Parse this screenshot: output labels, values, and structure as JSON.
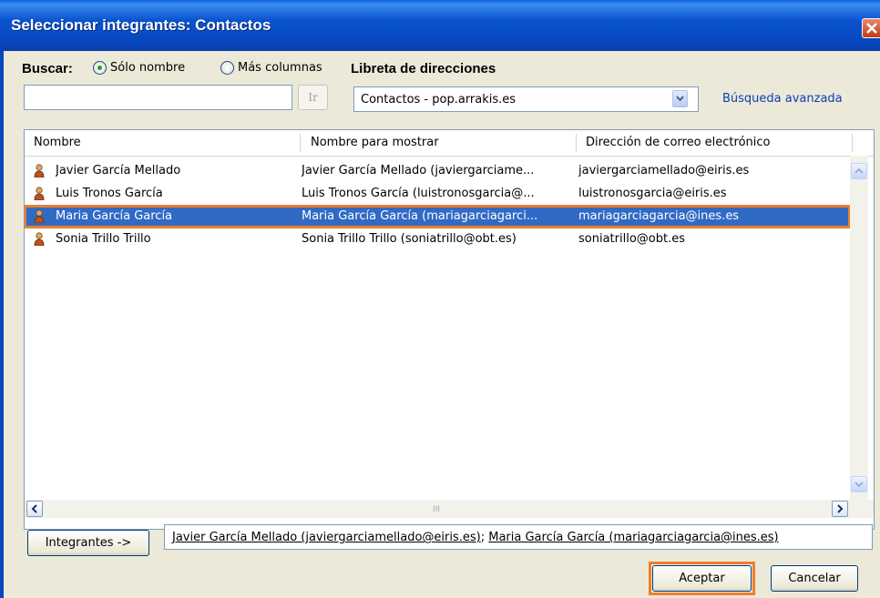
{
  "window": {
    "title": "Seleccionar integrantes: Contactos"
  },
  "search": {
    "label": "Buscar:",
    "option_name_only": "Sólo nombre",
    "option_more_columns": "Más columnas",
    "selected_option": "Sólo nombre",
    "query_value": "",
    "go_label": "Ir"
  },
  "address_book": {
    "label": "Libreta de direcciones",
    "selected": "Contactos - pop.arrakis.es",
    "advanced_search": "Búsqueda avanzada"
  },
  "table": {
    "columns": [
      "Nombre",
      "Nombre para mostrar",
      "Dirección de correo electrónico"
    ],
    "rows": [
      {
        "name": "Javier García Mellado",
        "display": "Javier García Mellado (javiergarciame...",
        "email": "javiergarciamellado@eiris.es",
        "selected": false
      },
      {
        "name": "Luis Tronos García",
        "display": "Luis Tronos García (luistronosgarcia@...",
        "email": "luistronosgarcia@eiris.es",
        "selected": false
      },
      {
        "name": "Maria García García",
        "display": "Maria García García (mariagarciagarci...",
        "email": "mariagarciagarcia@ines.es",
        "selected": true
      },
      {
        "name": "Sonia Trillo Trillo",
        "display": "Sonia Trillo Trillo (soniatrillo@obt.es)",
        "email": "soniatrillo@obt.es",
        "selected": false
      }
    ],
    "hscroll_grip": "III"
  },
  "members": {
    "button_label": "Integrantes ->",
    "entries": [
      "Javier García Mellado (javiergarciamellado@eiris.es)",
      "Maria García García (mariagarciagarcia@ines.es)"
    ],
    "separator": "; "
  },
  "footer": {
    "ok_label": "Aceptar",
    "cancel_label": "Cancelar"
  },
  "colors": {
    "title_bar": "#0a53cf",
    "selection": "#316ac5",
    "highlight": "#f07d2c",
    "dialog_bg": "#ece9d8"
  }
}
